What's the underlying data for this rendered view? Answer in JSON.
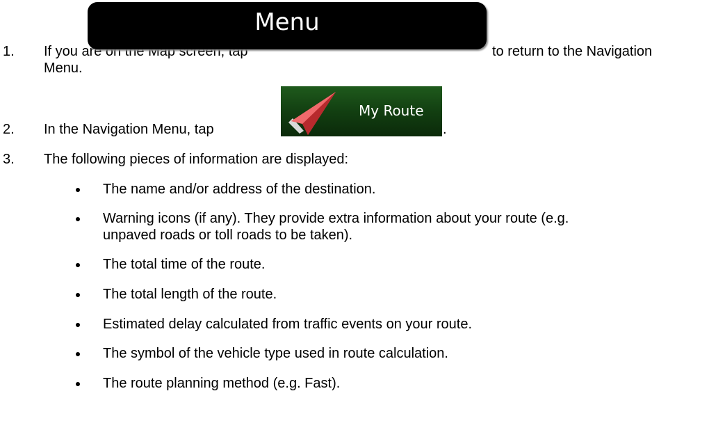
{
  "steps": [
    {
      "number": "1.",
      "text_before": "If you are on the Map screen, tap",
      "button_label": "Menu",
      "text_after": "to return to the Navigation",
      "text_continued": "Menu."
    },
    {
      "number": "2.",
      "text_before": "In the Navigation Menu, tap",
      "button_label": "My Route",
      "text_after": "."
    },
    {
      "number": "3.",
      "text": "The following pieces of information are displayed:"
    }
  ],
  "bullets": [
    {
      "lines": [
        "The name and/or address of the destination."
      ]
    },
    {
      "lines": [
        "Warning icons (if any). They provide extra information about your route (e.g.",
        "unpaved roads or toll roads to be taken)."
      ]
    },
    {
      "lines": [
        "The total time of the route."
      ]
    },
    {
      "lines": [
        "The total length of the route."
      ]
    },
    {
      "lines": [
        "Estimated delay calculated from traffic events on your route."
      ]
    },
    {
      "lines": [
        "The symbol of the vehicle type used in route calculation."
      ]
    },
    {
      "lines": [
        "The route planning method (e.g. Fast)."
      ]
    }
  ],
  "colors": {
    "menu_button_bg": "#000000",
    "route_button_bg": "#123f11",
    "route_arrow": "#e8474a"
  },
  "icons": {
    "route_icon": "route-arrow-icon"
  }
}
